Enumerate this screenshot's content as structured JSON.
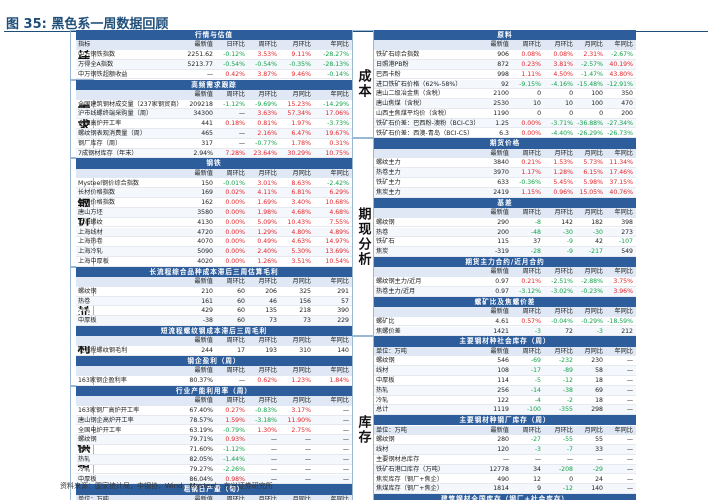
{
  "title": "图 35: 黑色系一周数据回顾",
  "footer": "资料来源：国家统计局，中钢协，Wind，Mysteel，东兴证券研究所",
  "colors": {
    "up": "#e4252a",
    "down": "#13a34b",
    "header": "#2e5d9c"
  },
  "left_labels": [
    "行情",
    "需求",
    "钢价",
    "行业盈利",
    "供给"
  ],
  "right_labels": [
    "成本",
    "期现分析",
    "库存"
  ],
  "cols5": [
    "最新值",
    "月环比",
    "周环比",
    "月同比",
    "年同比"
  ],
  "cols5b": [
    "最新值",
    "周环比",
    "月环比",
    "年同比"
  ],
  "left": [
    {
      "sec": "行情与估值",
      "hdr": [
        "指标",
        "最新值",
        "日环比",
        "周环比",
        "月环比",
        "年同比"
      ],
      "rows": [
        [
          "中万钢铁指数",
          "2251.62",
          "-0.12%",
          "3.53%",
          "9.11%",
          "-28.27%"
        ],
        [
          "万得全A指数",
          "5213.77",
          "-0.54%",
          "-0.54%",
          "-0.35%",
          "-28.13%"
        ],
        [
          "中万钢铁超额收益",
          "—",
          "0.42%",
          "3.87%",
          "9.46%",
          "-0.14%"
        ]
      ]
    },
    {
      "sec": "高频需求跟踪",
      "hdr": [
        "",
        "最新值",
        "周环比",
        "月环比",
        "月同比",
        "年同比"
      ],
      "rows": [
        [
          "全国建筑钢材成交量（237家钢贸商）",
          "209218",
          "-1.12%",
          "-9.69%",
          "15.23%",
          "-14.29%"
        ],
        [
          "沪市线螺终端采购量（周）",
          "34300",
          "—",
          "3.63%",
          "57.34%",
          "17.06%"
        ],
        [
          "全国高炉开工率",
          "441",
          "0.18%",
          "0.81%",
          "1.97%",
          "-3.73%"
        ],
        [
          "螺纹钢表观消费量（周）",
          "465",
          "—",
          "2.16%",
          "6.47%",
          "19.67%"
        ],
        [
          "钢厂库存（周）",
          "317",
          "—",
          "-0.77%",
          "1.78%",
          "0.31%"
        ],
        [
          "7成钢材库存（年末）",
          "2.94%",
          "7.28%",
          "23.64%",
          "30.29%",
          "10.75%"
        ]
      ]
    },
    {
      "sec": "钢铁",
      "hdr": [
        "",
        "最新值",
        "周环比",
        "月环比",
        "月同比",
        "年同比"
      ],
      "rows": [
        [
          "Mysteel钢价综合指数",
          "150",
          "-0.01%",
          "3.01%",
          "8.63%",
          "-2.42%"
        ],
        [
          "长材价格指数",
          "169",
          "0.02%",
          "4.11%",
          "6.81%",
          "6.29%"
        ],
        [
          "板材价格指数",
          "162",
          "0.00%",
          "1.69%",
          "3.40%",
          "10.68%"
        ],
        [
          "唐山方坯",
          "3580",
          "0.00%",
          "1.98%",
          "4.68%",
          "4.68%"
        ],
        [
          "上海螺纹",
          "4130",
          "0.00%",
          "5.09%",
          "10.43%",
          "7.55%"
        ],
        [
          "上海线材",
          "4720",
          "0.00%",
          "1.29%",
          "4.80%",
          "4.89%"
        ],
        [
          "上海热卷",
          "4070",
          "0.00%",
          "0.49%",
          "4.63%",
          "14.97%"
        ],
        [
          "上海冷轧",
          "5090",
          "0.00%",
          "2.40%",
          "5.30%",
          "13.69%"
        ],
        [
          "上海中厚板",
          "4020",
          "0.00%",
          "1.26%",
          "3.51%",
          "10.54%"
        ]
      ]
    },
    {
      "sec": "长流程综合品种成本滞后三周估算毛利",
      "hdr": [
        "",
        "最新值",
        "周环比",
        "月环比",
        "月同比",
        "年同比"
      ],
      "rows": [
        [
          "螺纹钢",
          "210",
          "60",
          "206",
          "325",
          "291"
        ],
        [
          "热卷",
          "161",
          "60",
          "46",
          "156",
          "57"
        ],
        [
          "冷轧",
          "429",
          "60",
          "135",
          "218",
          "390"
        ],
        [
          "中厚板",
          "-38",
          "60",
          "73",
          "73",
          "229"
        ]
      ]
    },
    {
      "sec": "短流程螺纹钢成本滞后三周毛利",
      "hdr": [
        "",
        "最新值",
        "周环比",
        "月环比",
        "月同比",
        "年同比"
      ],
      "rows": [
        [
          "短流程螺纹钢毛利",
          "244",
          "17",
          "193",
          "310",
          "140"
        ]
      ]
    },
    {
      "sec": "钢企盈利（周）",
      "hdr": [
        "",
        "最新值",
        "周环比",
        "月环比",
        "月同比",
        "年同比"
      ],
      "rows": [
        [
          "163家钢企盈利率",
          "80.37%",
          "—",
          "0.62%",
          "1.23%",
          "1.84%"
        ]
      ]
    },
    {
      "sec": "行业产能利用率（周）",
      "hdr": [
        "",
        "最新值",
        "周环比",
        "月环比",
        "月同比",
        "年同比"
      ],
      "rows": [
        [
          "163家钢厂高炉开工率",
          "67.40%",
          "0.27%",
          "-0.83%",
          "3.17%",
          "—"
        ],
        [
          "唐山钢企高炉开工率",
          "78.57%",
          "1.59%",
          "-3.18%",
          "11.90%",
          "—"
        ],
        [
          "全国电炉开工率",
          "63.19%",
          "-0.79%",
          "1.30%",
          "2.75%",
          "—"
        ],
        [
          "螺纹钢",
          "79.71%",
          "0.93%",
          "—",
          "—",
          "—"
        ],
        [
          "线材",
          "71.60%",
          "-1.12%",
          "—",
          "—",
          "—"
        ],
        [
          "热轧",
          "82.05%",
          "-1.44%",
          "—",
          "—",
          "—"
        ],
        [
          "冷轧",
          "79.27%",
          "-2.26%",
          "—",
          "—",
          "—"
        ],
        [
          "中厚板",
          "86.04%",
          "0.98%",
          "—",
          "—",
          "—"
        ]
      ]
    },
    {
      "sec": "粗钢日产量（旬）",
      "hdr": [
        "单位：万吨",
        "最新值",
        "周环比",
        "月环比",
        "月同比",
        "年同比"
      ],
      "rows": [
        [
          "国内粗钢预估日产量",
          "301",
          "-0.94%",
          "-2.37%",
          "14.54%",
          "—"
        ],
        [
          "重点钢铁企业日产量",
          "216",
          "-0.77%",
          "-1.47%",
          "9.58%",
          "—"
        ]
      ]
    }
  ],
  "right": [
    {
      "sec": "原料",
      "hdr": [
        "",
        "最新值",
        "周环比",
        "月环比",
        "月同比",
        "年同比"
      ],
      "rows": [
        [
          "铁矿石综合指数",
          "906",
          "0.08%",
          "0.08%",
          "2.31%",
          "-2.67%"
        ],
        [
          "日照港PB粉",
          "872",
          "0.23%",
          "3.81%",
          "-2.57%",
          "40.19%"
        ],
        [
          "巴西卡粉",
          "998",
          "1.11%",
          "4.50%",
          "-1.47%",
          "43.80%"
        ],
        [
          "进口铁矿石价格（62%-58%）",
          "92",
          "-9.15%",
          "-4.16%",
          "-15.48%",
          "-12.91%"
        ],
        [
          "唐山二级冶金焦（含税）",
          "2100",
          "0",
          "0",
          "100",
          "350"
        ],
        [
          "唐山焦煤（含税）",
          "2530",
          "10",
          "10",
          "100",
          "470"
        ],
        [
          "山西主焦煤平均价（含税）",
          "1190",
          "0",
          "0",
          "0",
          "200"
        ],
        [
          "铁矿石价差：巴西粉-澳粉（BCI-C3）",
          "1.25",
          "0.00%",
          "-3.71%",
          "-36.88%",
          "-27.34%"
        ],
        [
          "铁矿石价差：西澳-青岛（BCI-C5）",
          "6.3",
          "0.00%",
          "-4.40%",
          "-26.29%",
          "-26.73%"
        ]
      ]
    },
    {
      "sec": "期货价格",
      "hdr": [
        "",
        "最新值",
        "周环比",
        "月环比",
        "月同比",
        "年同比"
      ],
      "rows": [
        [
          "螺纹主力",
          "3840",
          "0.21%",
          "1.53%",
          "5.73%",
          "11.34%"
        ],
        [
          "热卷主力",
          "3970",
          "1.17%",
          "1.28%",
          "6.15%",
          "17.46%"
        ],
        [
          "铁矿主力",
          "633",
          "-0.36%",
          "5.45%",
          "5.98%",
          "37.15%"
        ],
        [
          "焦炭主力",
          "2419",
          "1.15%",
          "0.96%",
          "15.05%",
          "40.76%"
        ]
      ]
    },
    {
      "sec": "基差",
      "hdr": [
        "",
        "最新值",
        "周环比",
        "月环比",
        "月同比",
        "年同比"
      ],
      "rows": [
        [
          "螺纹钢",
          "290",
          "-8",
          "142",
          "182",
          "398"
        ],
        [
          "热卷",
          "200",
          "-48",
          "-30",
          "-30",
          "273"
        ],
        [
          "铁矿石",
          "115",
          "37",
          "-9",
          "42",
          "-107"
        ],
        [
          "焦炭",
          "-319",
          "-28",
          "-9",
          "-217",
          "549"
        ]
      ]
    },
    {
      "sec": "期货主力合约/近月合约",
      "hdr": [
        "",
        "最新值",
        "周环比",
        "月环比",
        "月同比",
        "年同比"
      ],
      "rows": [
        [
          "螺纹钢主力/近月",
          "0.97",
          "0.21%",
          "-2.51%",
          "-2.88%",
          "3.75%"
        ],
        [
          "热卷主力/近月",
          "0.97",
          "-3.12%",
          "-3.02%",
          "-0.23%",
          "3.96%"
        ]
      ]
    },
    {
      "sec": "螺矿比及焦螺价差",
      "hdr": [
        "",
        "最新值",
        "周环比",
        "月环比",
        "月同比",
        "年同比"
      ],
      "rows": [
        [
          "螺矿比",
          "4.61",
          "0.57%",
          "-0.04%",
          "-0.29%",
          "-18.59%"
        ],
        [
          "焦螺价差",
          "1421",
          "-3",
          "72",
          "-3",
          "212"
        ]
      ]
    },
    {
      "sec": "主要钢材种社会库存（周）",
      "hdr": [
        "单位：万吨",
        "最新值",
        "周环比",
        "月环比",
        "月同比",
        "年同比"
      ],
      "rows": [
        [
          "螺纹钢",
          "546",
          "-69",
          "-232",
          "230",
          "—"
        ],
        [
          "线材",
          "108",
          "-17",
          "-89",
          "58",
          "—"
        ],
        [
          "中厚板",
          "114",
          "-5",
          "-12",
          "18",
          "—"
        ],
        [
          "热轧",
          "256",
          "-14",
          "-38",
          "69",
          "—"
        ],
        [
          "冷轧",
          "122",
          "-4",
          "-2",
          "18",
          "—"
        ],
        [
          "总计",
          "1119",
          "-100",
          "-355",
          "298",
          "—"
        ]
      ]
    },
    {
      "sec": "主要钢材种钢厂库存（周）",
      "hdr": [
        "单位：万吨",
        "最新值",
        "周环比",
        "月环比",
        "月同比",
        "年同比"
      ],
      "rows": [
        [
          "螺纹钢",
          "280",
          "-27",
          "-55",
          "55",
          "—"
        ],
        [
          "线材",
          "120",
          "-3",
          "-7",
          "33",
          "—"
        ],
        [
          "主要钢材总库存",
          "—",
          "—",
          "—",
          "—",
          "—"
        ],
        [
          "铁矿石港口库存（万吨）",
          "12778",
          "34",
          "-208",
          "-29",
          "—"
        ],
        [
          "焦炭库存（钢厂+焦企）",
          "490",
          "12",
          "0",
          "24",
          "—"
        ],
        [
          "焦煤库存（钢厂+焦企）",
          "1814",
          "9",
          "-12",
          "140",
          "—"
        ]
      ]
    },
    {
      "sec": "建筑钢材全国库存（钢厂+社会库存）",
      "hdr": [
        "单位：万吨",
        "最新值",
        "周环比",
        "月环比",
        "月同比",
        "年同比"
      ],
      "rows": [
        [
          "合计",
          "996",
          "-112",
          "-354",
          "290",
          "—"
        ]
      ]
    }
  ]
}
